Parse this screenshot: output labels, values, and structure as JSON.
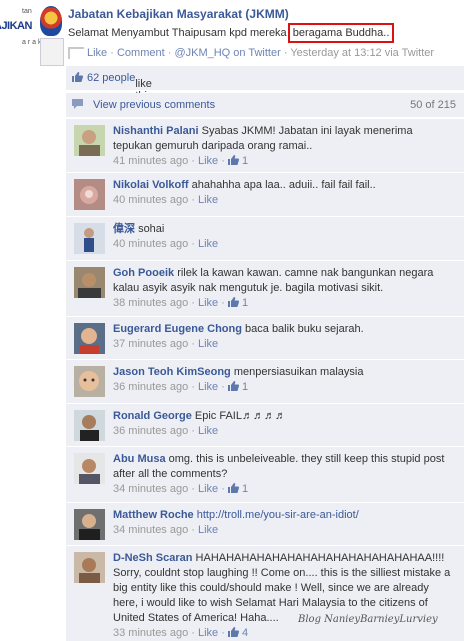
{
  "post": {
    "logo_text": "AJIKAN",
    "logo_small_top": "tan",
    "logo_small_bottom": "a r a k a t",
    "author": "Jabatan Kebajikan Masyarakat (JKMM)",
    "text_before": "Selamat Menyambut Thaipusam kpd mereka ",
    "text_highlight": "beragama Buddha..",
    "meta": {
      "like": "Like",
      "sep1": " · ",
      "comment": "Comment",
      "sep2": " · ",
      "handle": "@JKM_HQ on Twitter",
      "sep3": " · ",
      "time": "Yesterday at 13:12 via Twitter"
    }
  },
  "likes": {
    "count": "62 people",
    "suffix": " like this."
  },
  "view_previous": {
    "label": "View previous comments",
    "count": "50 of 215"
  },
  "comments": [
    {
      "author": "Nishanthi Palani",
      "text": "Syabas JKMM! Jabatan ini layak menerima tepukan gemuruh daripada orang ramai..",
      "time": "41 minutes ago",
      "like": "Like",
      "likes": "1"
    },
    {
      "author": "Nikolai Volkoff",
      "text": "ahahahha apa laa.. aduii.. fail fail fail..",
      "time": "40 minutes ago",
      "like": "Like",
      "likes": ""
    },
    {
      "author": "偉深",
      "text": "sohai",
      "time": "40 minutes ago",
      "like": "Like",
      "likes": ""
    },
    {
      "author": "Goh Pooeik",
      "text": "rilek la kawan kawan. camne nak bangunkan negara kalau asyik asyik nak mengutuk je. bagila motivasi sikit.",
      "time": "38 minutes ago",
      "like": "Like",
      "likes": "1"
    },
    {
      "author": "Eugerard Eugene Chong",
      "text": "baca balik buku sejarah.",
      "time": "37 minutes ago",
      "like": "Like",
      "likes": ""
    },
    {
      "author": "Jason Teoh KimSeong",
      "text": "menpersiasuikan malaysia",
      "time": "36 minutes ago",
      "like": "Like",
      "likes": "1"
    },
    {
      "author": "Ronald George",
      "text": "Epic FAIL♬♬♬♬",
      "time": "36 minutes ago",
      "like": "Like",
      "likes": ""
    },
    {
      "author": "Abu Musa",
      "text": "omg. this is unbeleiveable. they still keep this stupid post after all the comments?",
      "time": "34 minutes ago",
      "like": "Like",
      "likes": "1"
    },
    {
      "author": "Matthew Roche",
      "text": "http://troll.me/you-sir-are-an-idiot/",
      "time": "34 minutes ago",
      "like": "Like",
      "likes": ""
    },
    {
      "author": "D-NeSh Scaran",
      "text": "HAHAHAHAHAHAHAHAHAHAHAHAHAHAHAA!!!! Sorry, couldnt stop laughing !! Come on.... this is the silliest mistake a big entity like this could/should make ! Well, since we are already here, i would like to wish Selamat Hari Malaysia to the citizens of United States of America! Haha....",
      "time": "33 minutes ago",
      "like": "Like",
      "likes": "4"
    }
  ],
  "watermark": "Blog NanieyBarnieyLurviey",
  "colors": {
    "fb_blue": "#3b5998",
    "comment_bg": "#edeff4",
    "highlight_box": "#d11111"
  }
}
